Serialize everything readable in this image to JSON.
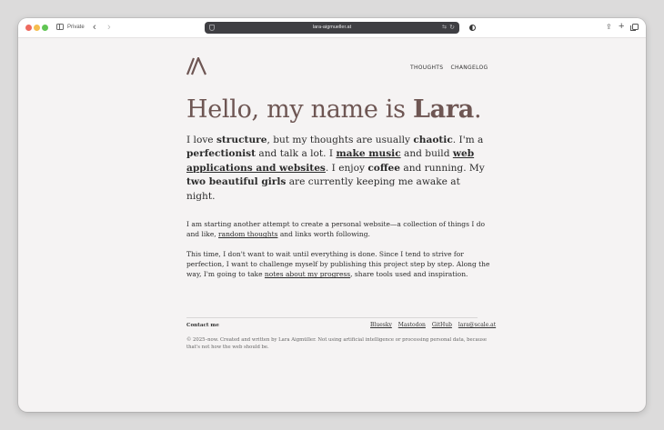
{
  "browser": {
    "private_label": "Private",
    "url": "lara-aigmueller.at"
  },
  "nav": {
    "items": [
      "THOUGHTS",
      "CHANGELOG"
    ]
  },
  "hero": {
    "greeting": "Hello, my name is ",
    "name": "Lara",
    "period": "."
  },
  "intro": {
    "t1": "I love ",
    "b1": "structure",
    "t2": ", but my thoughts are usually ",
    "b2": "chaotic",
    "t3": ". I'm a ",
    "b3": "perfectionist",
    "t4": " and talk a lot. I ",
    "l1": "make music",
    "t5": " and build ",
    "l2": "web applications and websites",
    "t6": ". I enjoy ",
    "b4": "coffee",
    "t7": " and running. My ",
    "b5": "two beautiful girls",
    "t8": " are currently keeping me awake at night."
  },
  "para1": {
    "t1": "I am starting another attempt to create a personal website—a collection of things I do and like, ",
    "l1": "random thoughts",
    "t2": " and links worth following."
  },
  "para2": {
    "t1": "This time, I don't want to wait until everything is done. Since I tend to strive for perfection, I want to challenge myself by publishing this project step by step. Along the way, I'm going to take ",
    "l1": "notes about my progress",
    "t2": ", share tools used and inspiration."
  },
  "footer": {
    "contact_label": "Contact me",
    "links": [
      "Bluesky",
      "Mastodon",
      "GitHub",
      "lara@scale.at"
    ],
    "copyright": "© 2025–now. Created and written by Lara Aigmüller. Not using artificial intelligence or processing personal data, because that's not how the web should be."
  },
  "colors": {
    "accent": "#6e5653",
    "background": "#f5f3f3"
  }
}
